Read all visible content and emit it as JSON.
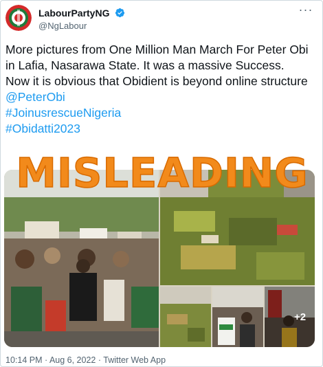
{
  "account": {
    "display_name": "LabourPartyNG",
    "handle": "@NgLabour",
    "verified_icon": "verified-badge-icon",
    "brand_color": "#1d9bf0"
  },
  "menu": {
    "more_label": "···"
  },
  "tweet": {
    "text_line_1": "More pictures from One Million Man March For Peter Obi in Lafia, Nasarawa State. It was a massive Success.",
    "text_line_2": "Now it is obvious that Obidient is beyond online structure",
    "mention": "@PeterObi",
    "hashtag_1": "#JoinusrescueNigeria",
    "hashtag_2": "#Obidatti2023"
  },
  "media": {
    "extra_count": "+2"
  },
  "overlay": {
    "label": "MISLEADING",
    "color": "#f28a1b"
  },
  "meta": {
    "time": "10:14 PM",
    "separator_1": " · ",
    "date": "Aug 6, 2022",
    "separator_2": " · ",
    "client": "Twitter Web App"
  }
}
